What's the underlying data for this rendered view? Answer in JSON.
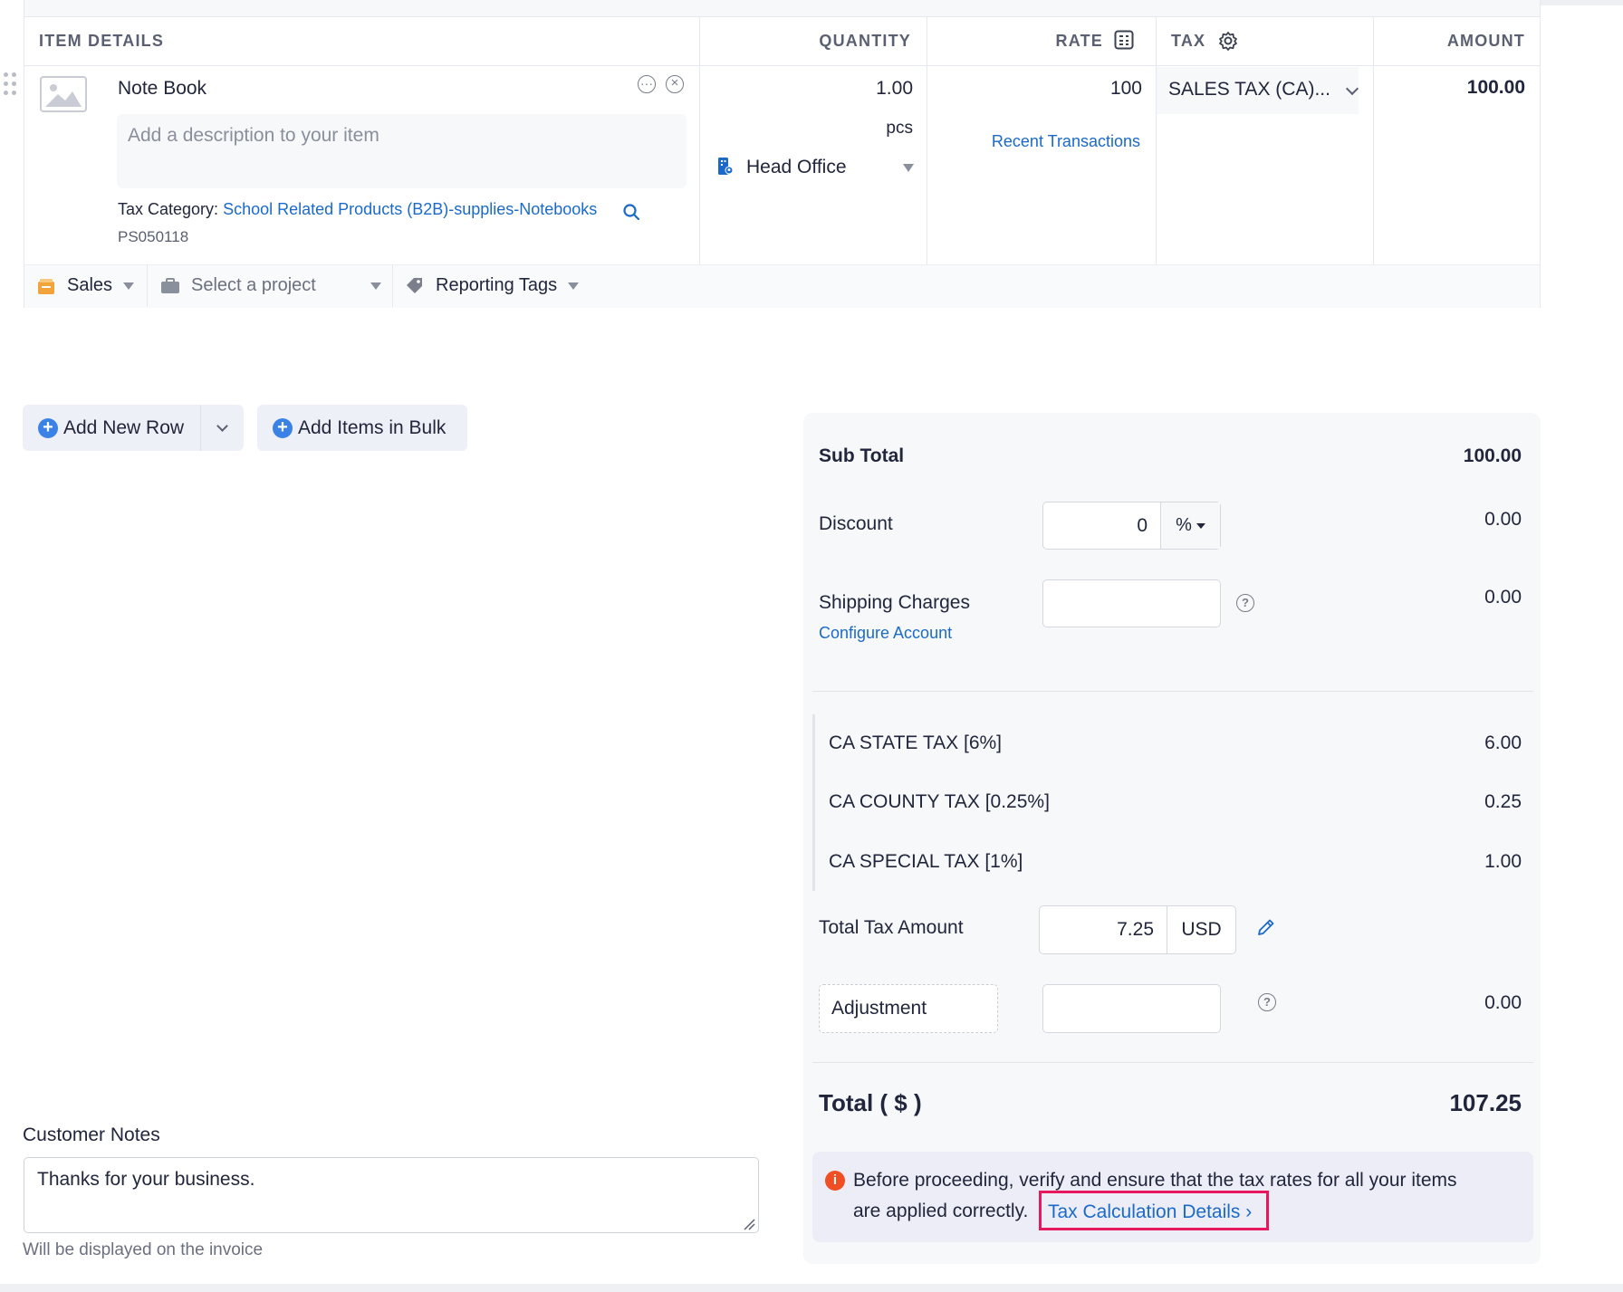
{
  "table": {
    "headers": {
      "item": "ITEM DETAILS",
      "quantity": "QUANTITY",
      "rate": "RATE",
      "tax": "TAX",
      "amount": "AMOUNT"
    },
    "row": {
      "name": "Note Book",
      "description_placeholder": "Add a description to your item",
      "tax_category_label": "Tax Category:",
      "tax_category_value": "School Related Products (B2B)-supplies-Notebooks",
      "code": "PS050118",
      "quantity": "1.00",
      "unit": "pcs",
      "location": "Head Office",
      "rate": "100",
      "recent_transactions": "Recent Transactions",
      "tax": "SALES TAX (CA)...",
      "amount": "100.00"
    },
    "footer": {
      "sales": "Sales",
      "project": "Select a project",
      "tags": "Reporting Tags"
    }
  },
  "buttons": {
    "add_row": "Add New Row",
    "add_bulk": "Add Items in Bulk"
  },
  "totals": {
    "subtotal_label": "Sub Total",
    "subtotal": "100.00",
    "discount_label": "Discount",
    "discount_input": "0",
    "discount_unit": "%",
    "discount": "0.00",
    "shipping_label": "Shipping Charges",
    "configure_account": "Configure Account",
    "shipping": "0.00",
    "taxes": [
      {
        "label": "CA STATE TAX [6%]",
        "value": "6.00"
      },
      {
        "label": "CA COUNTY TAX [0.25%]",
        "value": "0.25"
      },
      {
        "label": "CA SPECIAL TAX [1%]",
        "value": "1.00"
      }
    ],
    "total_tax_label": "Total Tax Amount",
    "total_tax_input": "7.25",
    "total_tax_currency": "USD",
    "adjustment_label": "Adjustment",
    "adjustment": "0.00",
    "total_label": "Total ( $ )",
    "total": "107.25",
    "note_text_1": "Before proceeding, verify and ensure that the tax rates for all your items",
    "note_text_2": "are applied correctly.",
    "note_link": "Tax Calculation Details ›"
  },
  "customer_notes": {
    "label": "Customer Notes",
    "value": "Thanks for your business.",
    "hint": "Will be displayed on the invoice"
  },
  "colors": {
    "accent": "#1b6ac9",
    "highlight": "#e8185f",
    "info": "#f04e23",
    "add": "#3b82e6"
  }
}
